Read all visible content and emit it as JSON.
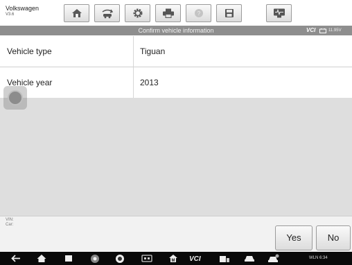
{
  "header": {
    "app_name": "Volkswagen",
    "app_version": "V3.6"
  },
  "toolbar": {
    "buttons": [
      {
        "name": "home-icon"
      },
      {
        "name": "vehicle-swap-icon"
      },
      {
        "name": "settings-icon"
      },
      {
        "name": "print-icon"
      },
      {
        "name": "help-icon"
      },
      {
        "name": "save-icon"
      },
      {
        "name": "data-logging-icon"
      }
    ]
  },
  "subbar": {
    "title": "Confirm vehicle information",
    "vci": "VCI",
    "voltage": "11.95V"
  },
  "rows": [
    {
      "label": "Vehicle type",
      "value": "Tiguan"
    },
    {
      "label": "Vehicle year",
      "value": "2013"
    }
  ],
  "footer": {
    "vin_label": "VIN:",
    "car_label": "Car:",
    "yes_label": "Yes",
    "no_label": "No"
  },
  "navbar": {
    "items": [
      "back-icon",
      "home-icon",
      "recent-apps-icon",
      "chrome-icon",
      "camera-icon",
      "screen-mirror-icon",
      "maxisys-home-icon",
      "vci-icon",
      "shop-manager-icon",
      "vehicle-icon",
      "service-icon"
    ],
    "status_text": "WLN 6:34"
  },
  "colors": {
    "subbar_bg": "#8e8e8e",
    "content_bg": "#dedede",
    "navbar_bg": "#0a0a0a"
  }
}
